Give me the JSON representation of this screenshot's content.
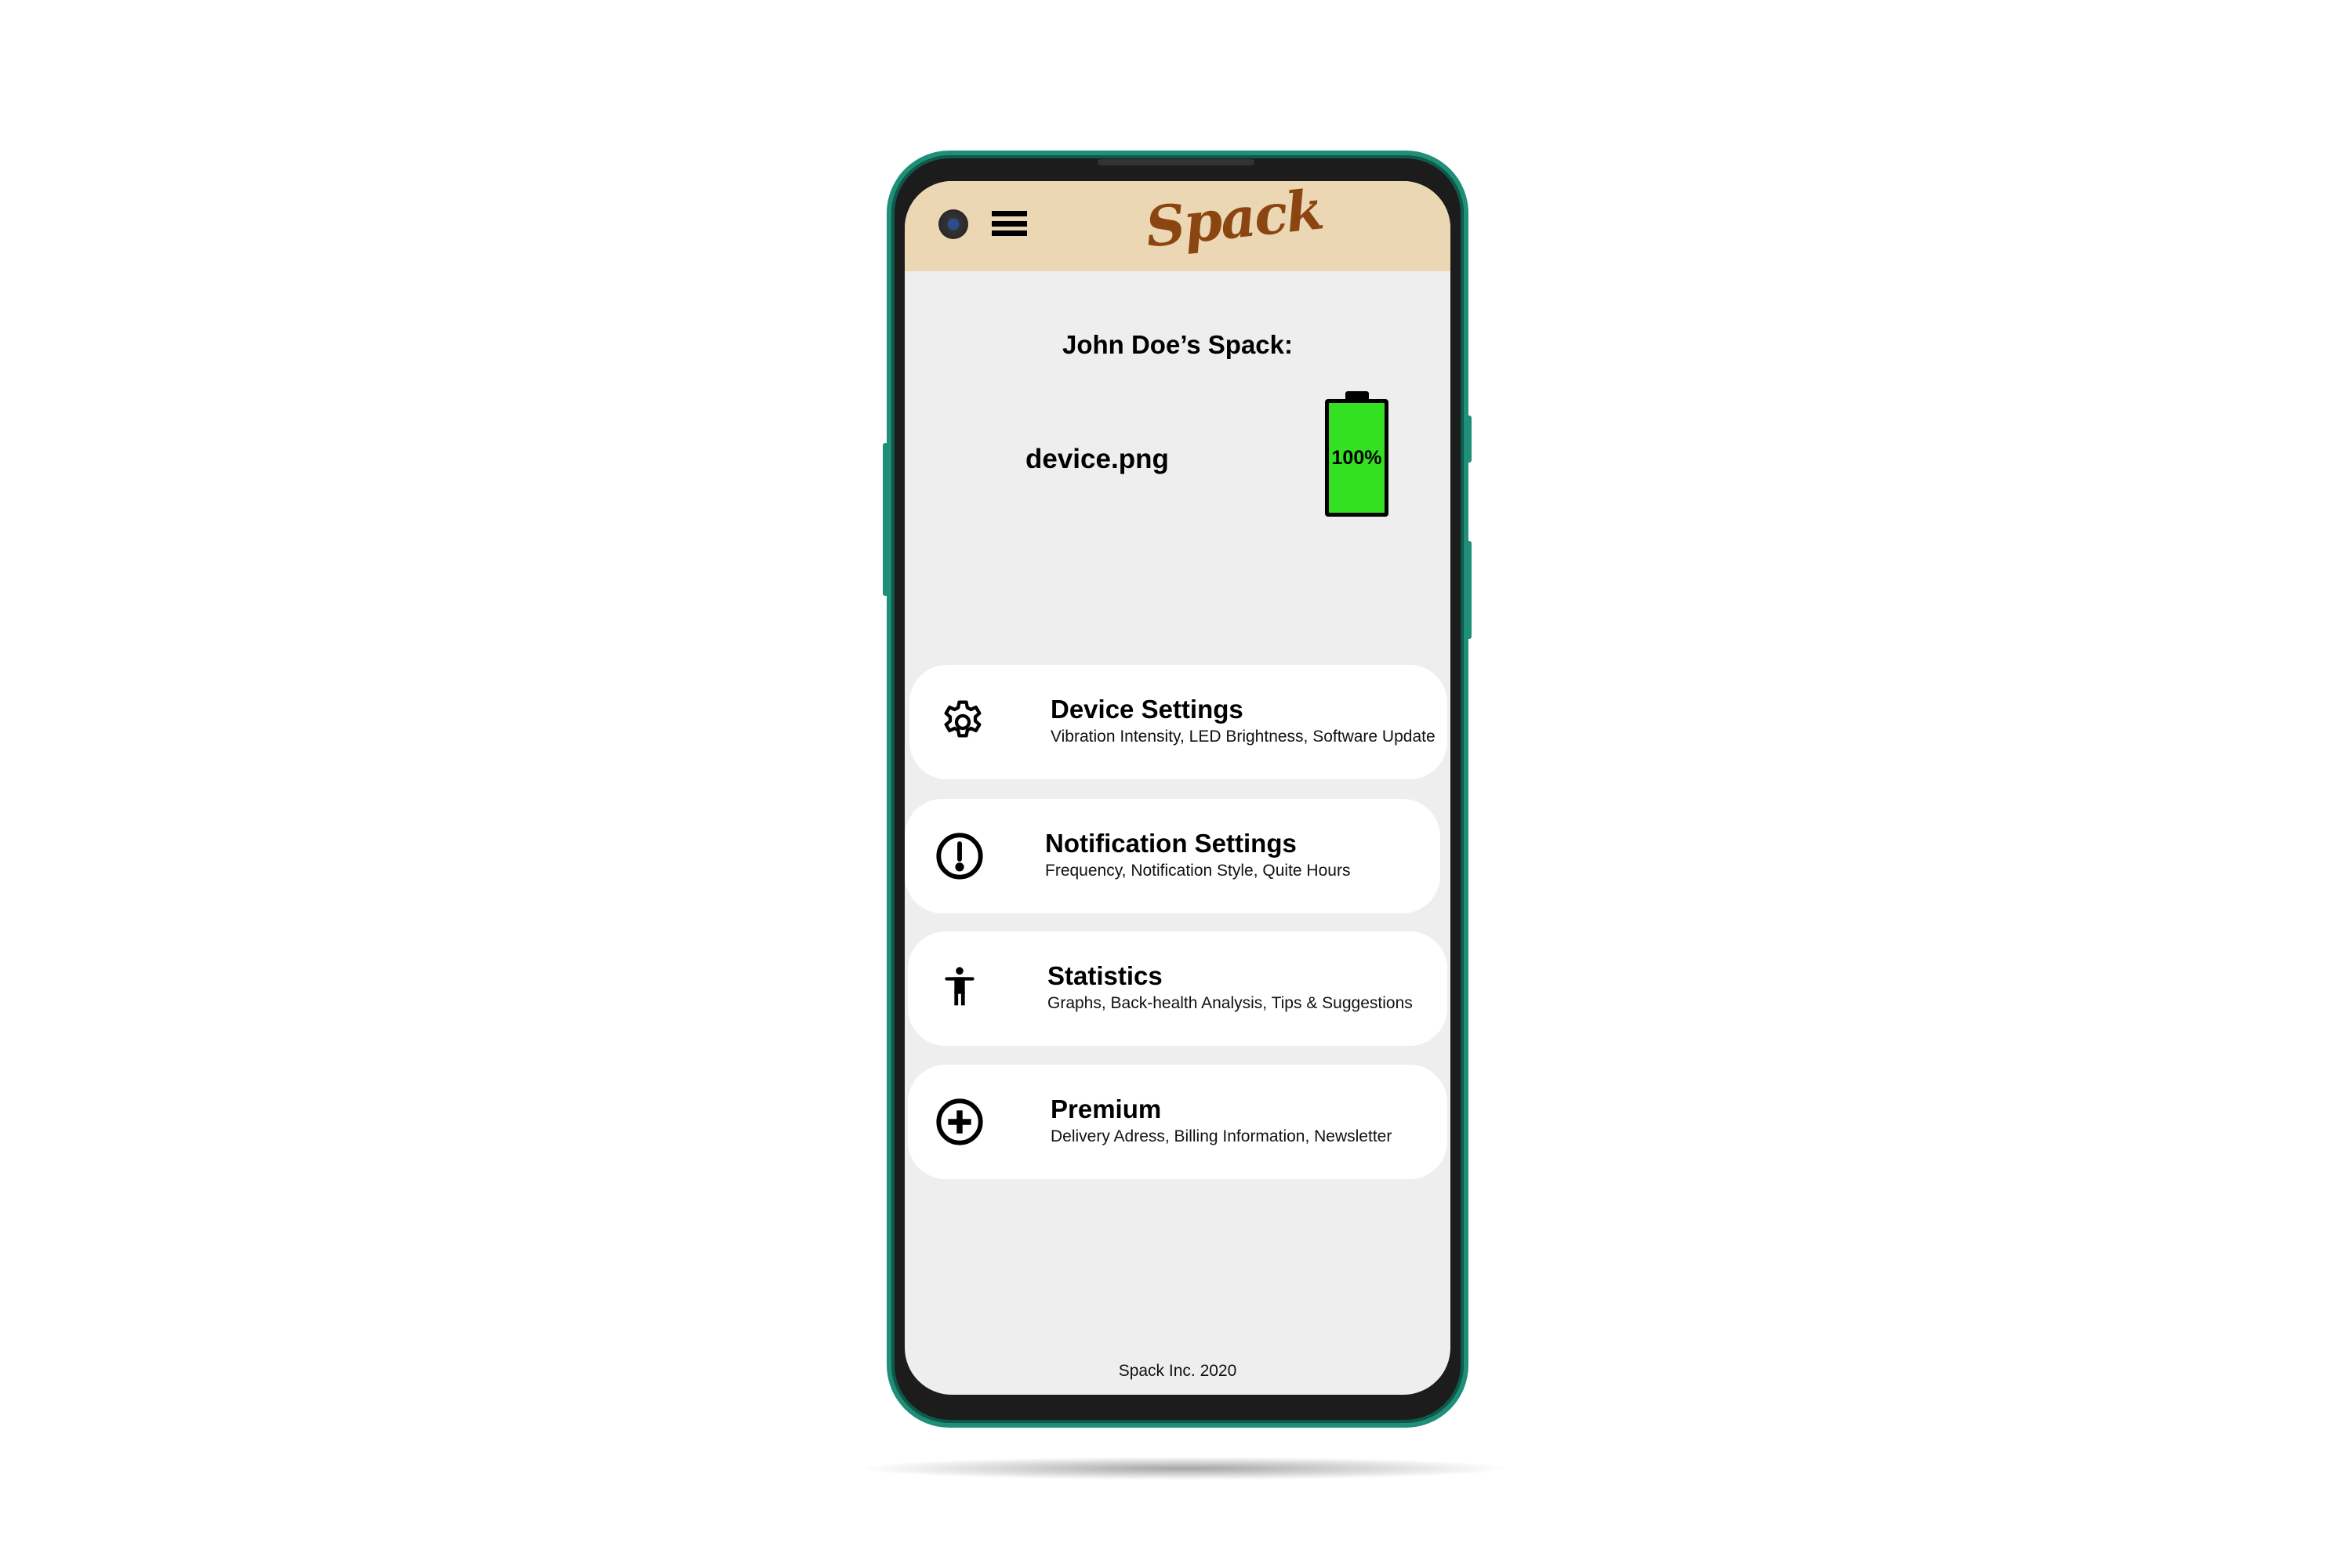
{
  "app": {
    "logo_text": "Spack"
  },
  "owner": {
    "title": "John Doe’s Spack:"
  },
  "device": {
    "image_label": "device.png",
    "battery_label": "100%",
    "battery_percent": 100,
    "battery_color": "#33e022"
  },
  "menu": [
    {
      "title": "Device Settings",
      "subtitle": "Vibration Intensity, LED Brightness, Software Update",
      "icon": "gear-icon"
    },
    {
      "title": "Notification Settings",
      "subtitle": "Frequency, Notification Style, Quite Hours",
      "icon": "alert-circle-icon"
    },
    {
      "title": "Statistics",
      "subtitle": "Graphs, Back-health Analysis, Tips & Suggestions",
      "icon": "person-icon"
    },
    {
      "title": "Premium",
      "subtitle": "Delivery Adress, Billing Information, Newsletter",
      "icon": "plus-circle-icon"
    }
  ],
  "footer": {
    "text": "Spack Inc. 2020"
  },
  "colors": {
    "header": "#ecd7b4",
    "logo": "#8b4511",
    "frame": "#1f8f77"
  }
}
